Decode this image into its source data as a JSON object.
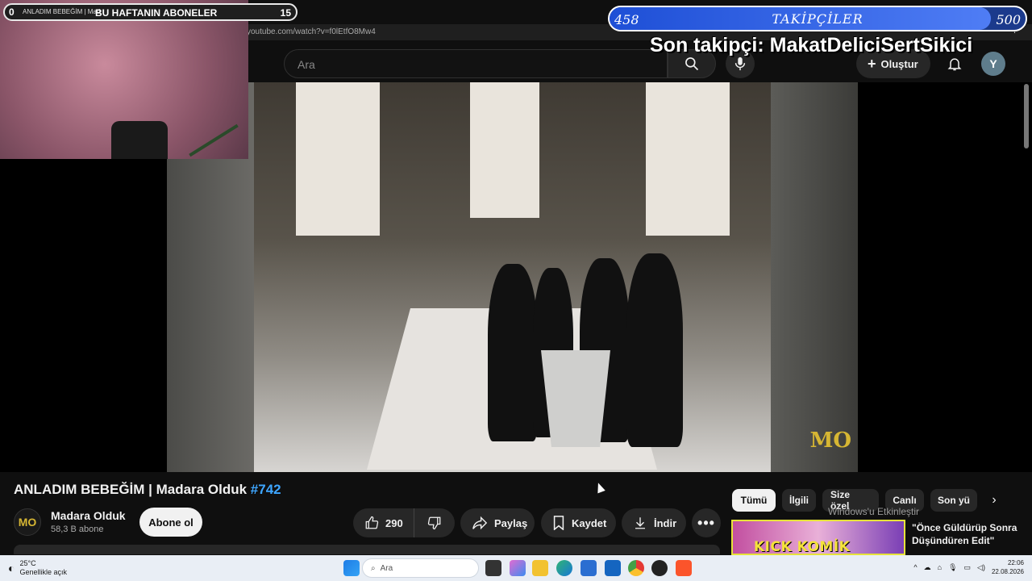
{
  "browser": {
    "url": "youtube.com/watch?v=f0lEtfO8Mw4"
  },
  "yt_header": {
    "search_placeholder": "Ara",
    "create_label": "Oluştur",
    "avatar_letter": "Y"
  },
  "video": {
    "title": "ANLADIM BEBEĞİM | Madara Olduk",
    "hashtag": "#742",
    "watermark": "MO",
    "channel_logo_text": "MO",
    "channel_name": "Madara Olduk",
    "subscribers": "58,3 B abone",
    "subscribe_label": "Abone ol",
    "likes": "290",
    "share_label": "Paylaş",
    "save_label": "Kaydet",
    "download_label": "İndir"
  },
  "chips": [
    {
      "label": "Tümü",
      "active": true
    },
    {
      "label": "İlgili"
    },
    {
      "label": "Size özel"
    },
    {
      "label": "Canlı"
    },
    {
      "label": "Son yü"
    }
  ],
  "recommendation": {
    "thumb_text": "KICK KOMİK ANLAR",
    "title": "\"Önce Güldürüp Sonra Düşündüren Edit\""
  },
  "windows_watermark": "Windows'u Etkinleştir",
  "stream_overlay": {
    "sub_count_left": "0",
    "tab_text": "ANLADIM BEBEĞİM | Mad",
    "sub_label": "BU HAFTANIN ABONELER",
    "sub_count_right": "15",
    "followers_current": "458",
    "followers_label": "TAKİPÇİLER",
    "followers_goal": "500",
    "followers_progress": 0.916,
    "last_follower": "Son takipçi: MakatDeliciSertSikici"
  },
  "taskbar": {
    "temperature": "25°C",
    "weather_desc": "Genellikle açık",
    "search_label": "Ara",
    "time": "22:06",
    "date": "22.08.2026"
  }
}
